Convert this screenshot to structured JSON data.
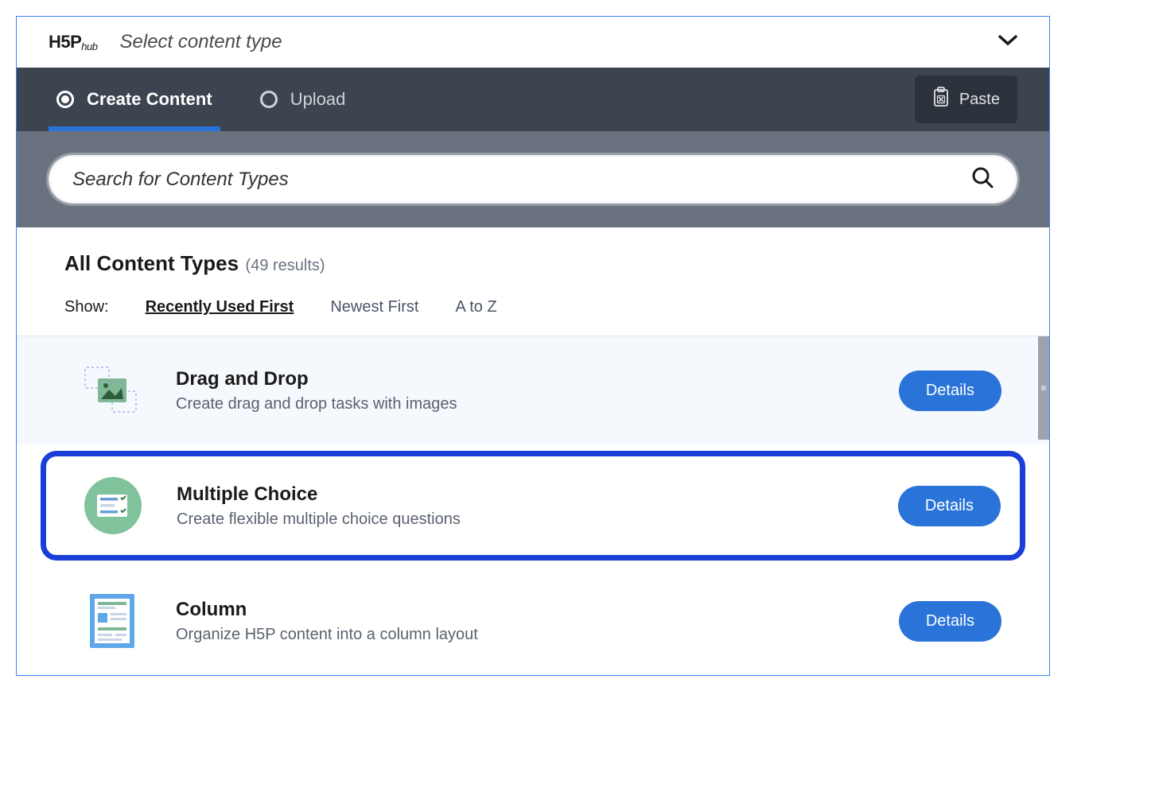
{
  "header": {
    "logo_main": "H5P",
    "logo_sub": "hub",
    "title": "Select content type"
  },
  "tabs": {
    "create": "Create Content",
    "upload": "Upload",
    "paste": "Paste"
  },
  "search": {
    "placeholder": "Search for Content Types"
  },
  "filter": {
    "title": "All Content Types",
    "count": "(49 results)",
    "show_label": "Show:",
    "sort_options": [
      "Recently Used First",
      "Newest First",
      "A to Z"
    ]
  },
  "items": [
    {
      "title": "Drag and Drop",
      "desc": "Create drag and drop tasks with images",
      "button": "Details"
    },
    {
      "title": "Multiple Choice",
      "desc": "Create flexible multiple choice questions",
      "button": "Details"
    },
    {
      "title": "Column",
      "desc": "Organize H5P content into a column layout",
      "button": "Details"
    }
  ]
}
